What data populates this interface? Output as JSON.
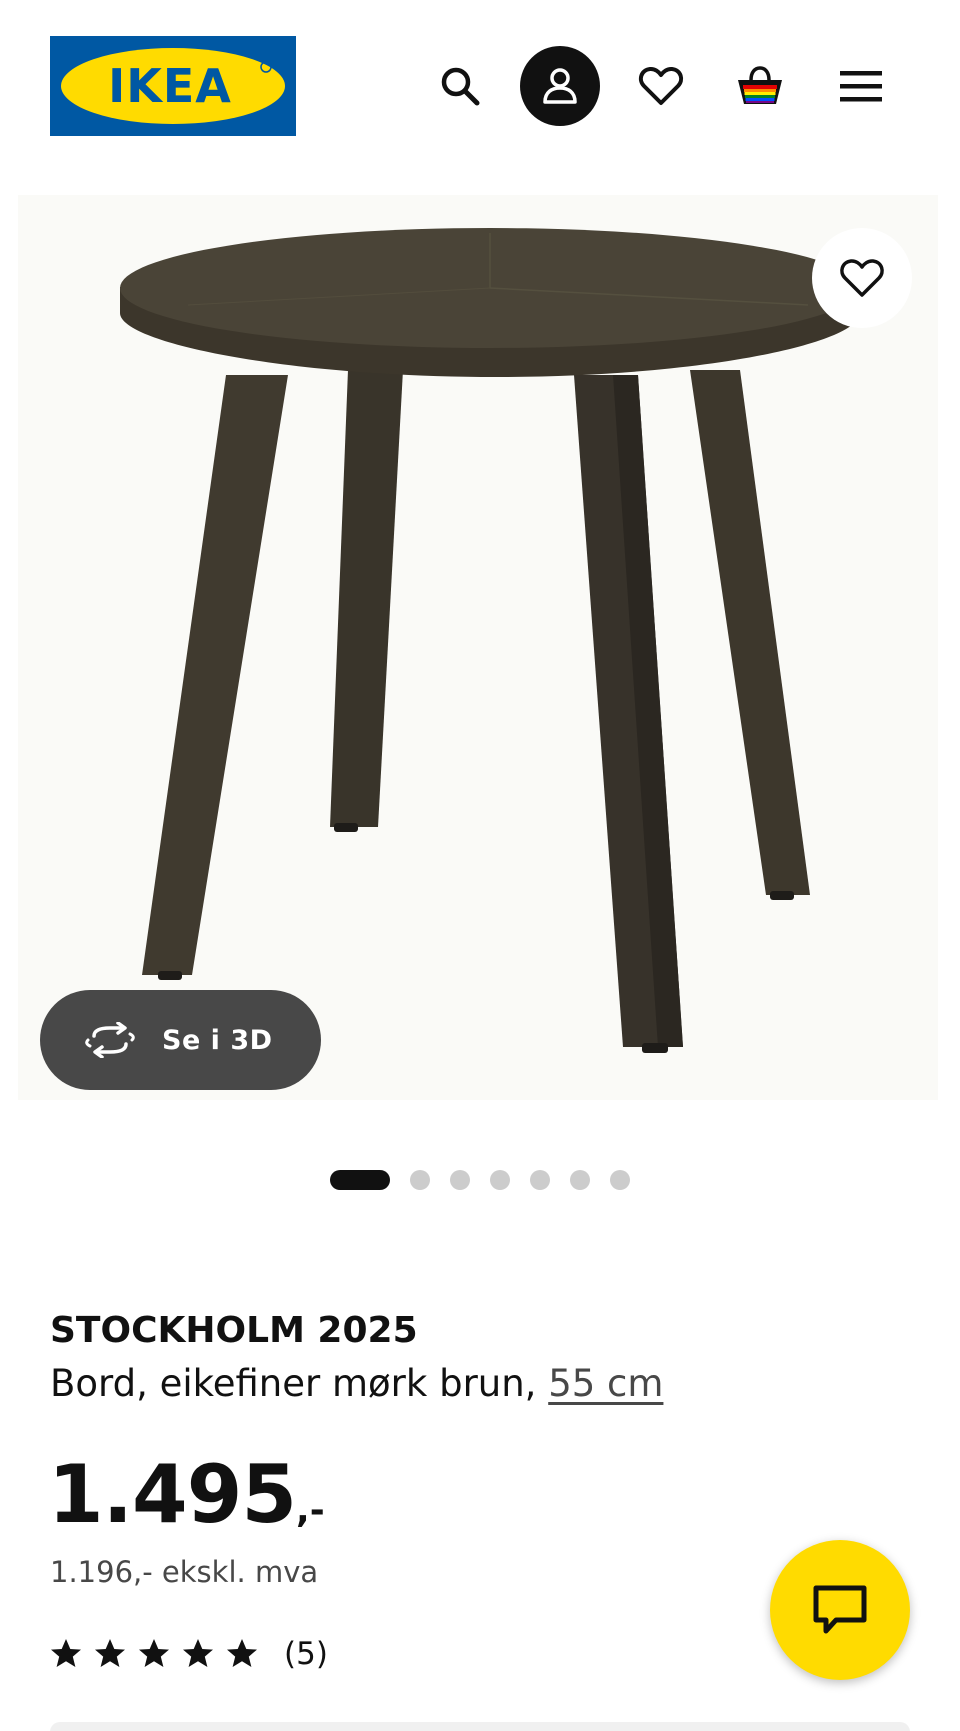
{
  "header": {
    "logo_text": "IKEA",
    "icons": [
      "search-icon",
      "user-icon",
      "heart-icon",
      "shopping-bag-icon",
      "hamburger-menu-icon"
    ]
  },
  "gallery": {
    "view_3d_label": "Se i 3D",
    "slide_count": 7,
    "active_slide": 1
  },
  "product": {
    "name": "STOCKHOLM 2025",
    "description": "Bord, eikefiner mørk brun, ",
    "size": "55 cm",
    "price_integer": "1.495",
    "price_suffix": ",-",
    "price_ex_vat": "1.196,- ekskl. mva",
    "rating_stars": 5,
    "review_count": "(5)"
  },
  "colors": {
    "brand_blue": "#0058a3",
    "brand_yellow": "#ffdb00",
    "view3d_bg": "#484848"
  }
}
